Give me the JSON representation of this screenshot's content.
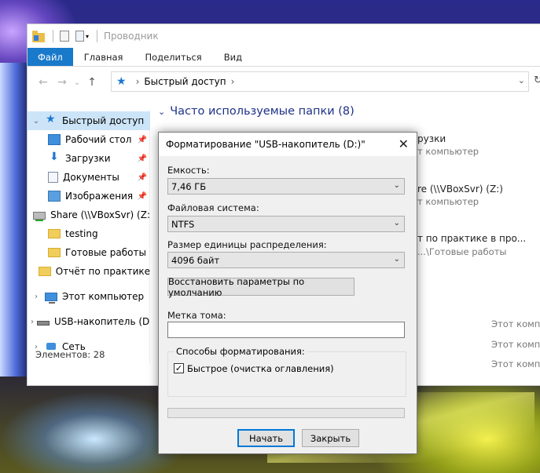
{
  "explorer": {
    "title": "Проводник",
    "ribbon_tabs": [
      "Файл",
      "Главная",
      "Поделиться",
      "Вид"
    ],
    "address": {
      "location": "Быстрый доступ"
    },
    "sidebar": {
      "quick_access": "Быстрый доступ",
      "items": [
        {
          "label": "Рабочий стол",
          "pinned": true
        },
        {
          "label": "Загрузки",
          "pinned": true
        },
        {
          "label": "Документы",
          "pinned": true
        },
        {
          "label": "Изображения",
          "pinned": true
        },
        {
          "label": "Share (\\\\VBoxSvr) (Z:",
          "pinned": false
        },
        {
          "label": "testing",
          "pinned": false
        },
        {
          "label": "Готовые работы",
          "pinned": false
        },
        {
          "label": "Отчёт по практике",
          "pinned": false
        }
      ],
      "this_pc": "Этот компьютер",
      "usb": "USB-накопитель (D:)",
      "network": "Сеть"
    },
    "status": "Элементов: 28",
    "content": {
      "header": "Часто используемые папки (8)",
      "fragments": {
        "f1_name": "рузки",
        "f1_loc": "т компьютер",
        "f2_name": "re (\\\\VBoxSvr) (Z:)",
        "f2_loc": "т компьютер",
        "f3_name": "т по практике в про...",
        "f3_loc": "...\\Готовые работы",
        "r1": "Этот компь",
        "r2": "Этот компь",
        "r3": "Этот компь"
      }
    }
  },
  "dialog": {
    "title": "Форматирование \"USB-накопитель (D:)\"",
    "capacity_label": "Емкость:",
    "capacity_value": "7,46 ГБ",
    "fs_label": "Файловая система:",
    "fs_value": "NTFS",
    "alloc_label": "Размер единицы распределения:",
    "alloc_value": "4096 байт",
    "restore_button": "Восстановить параметры по умолчанию",
    "volume_label": "Метка тома:",
    "volume_value": "",
    "options_label": "Способы форматирования:",
    "quick_format_label": "Быстрое (очистка оглавления)",
    "quick_format_checked": true,
    "progress": 0,
    "start_button": "Начать",
    "close_button": "Закрыть"
  }
}
